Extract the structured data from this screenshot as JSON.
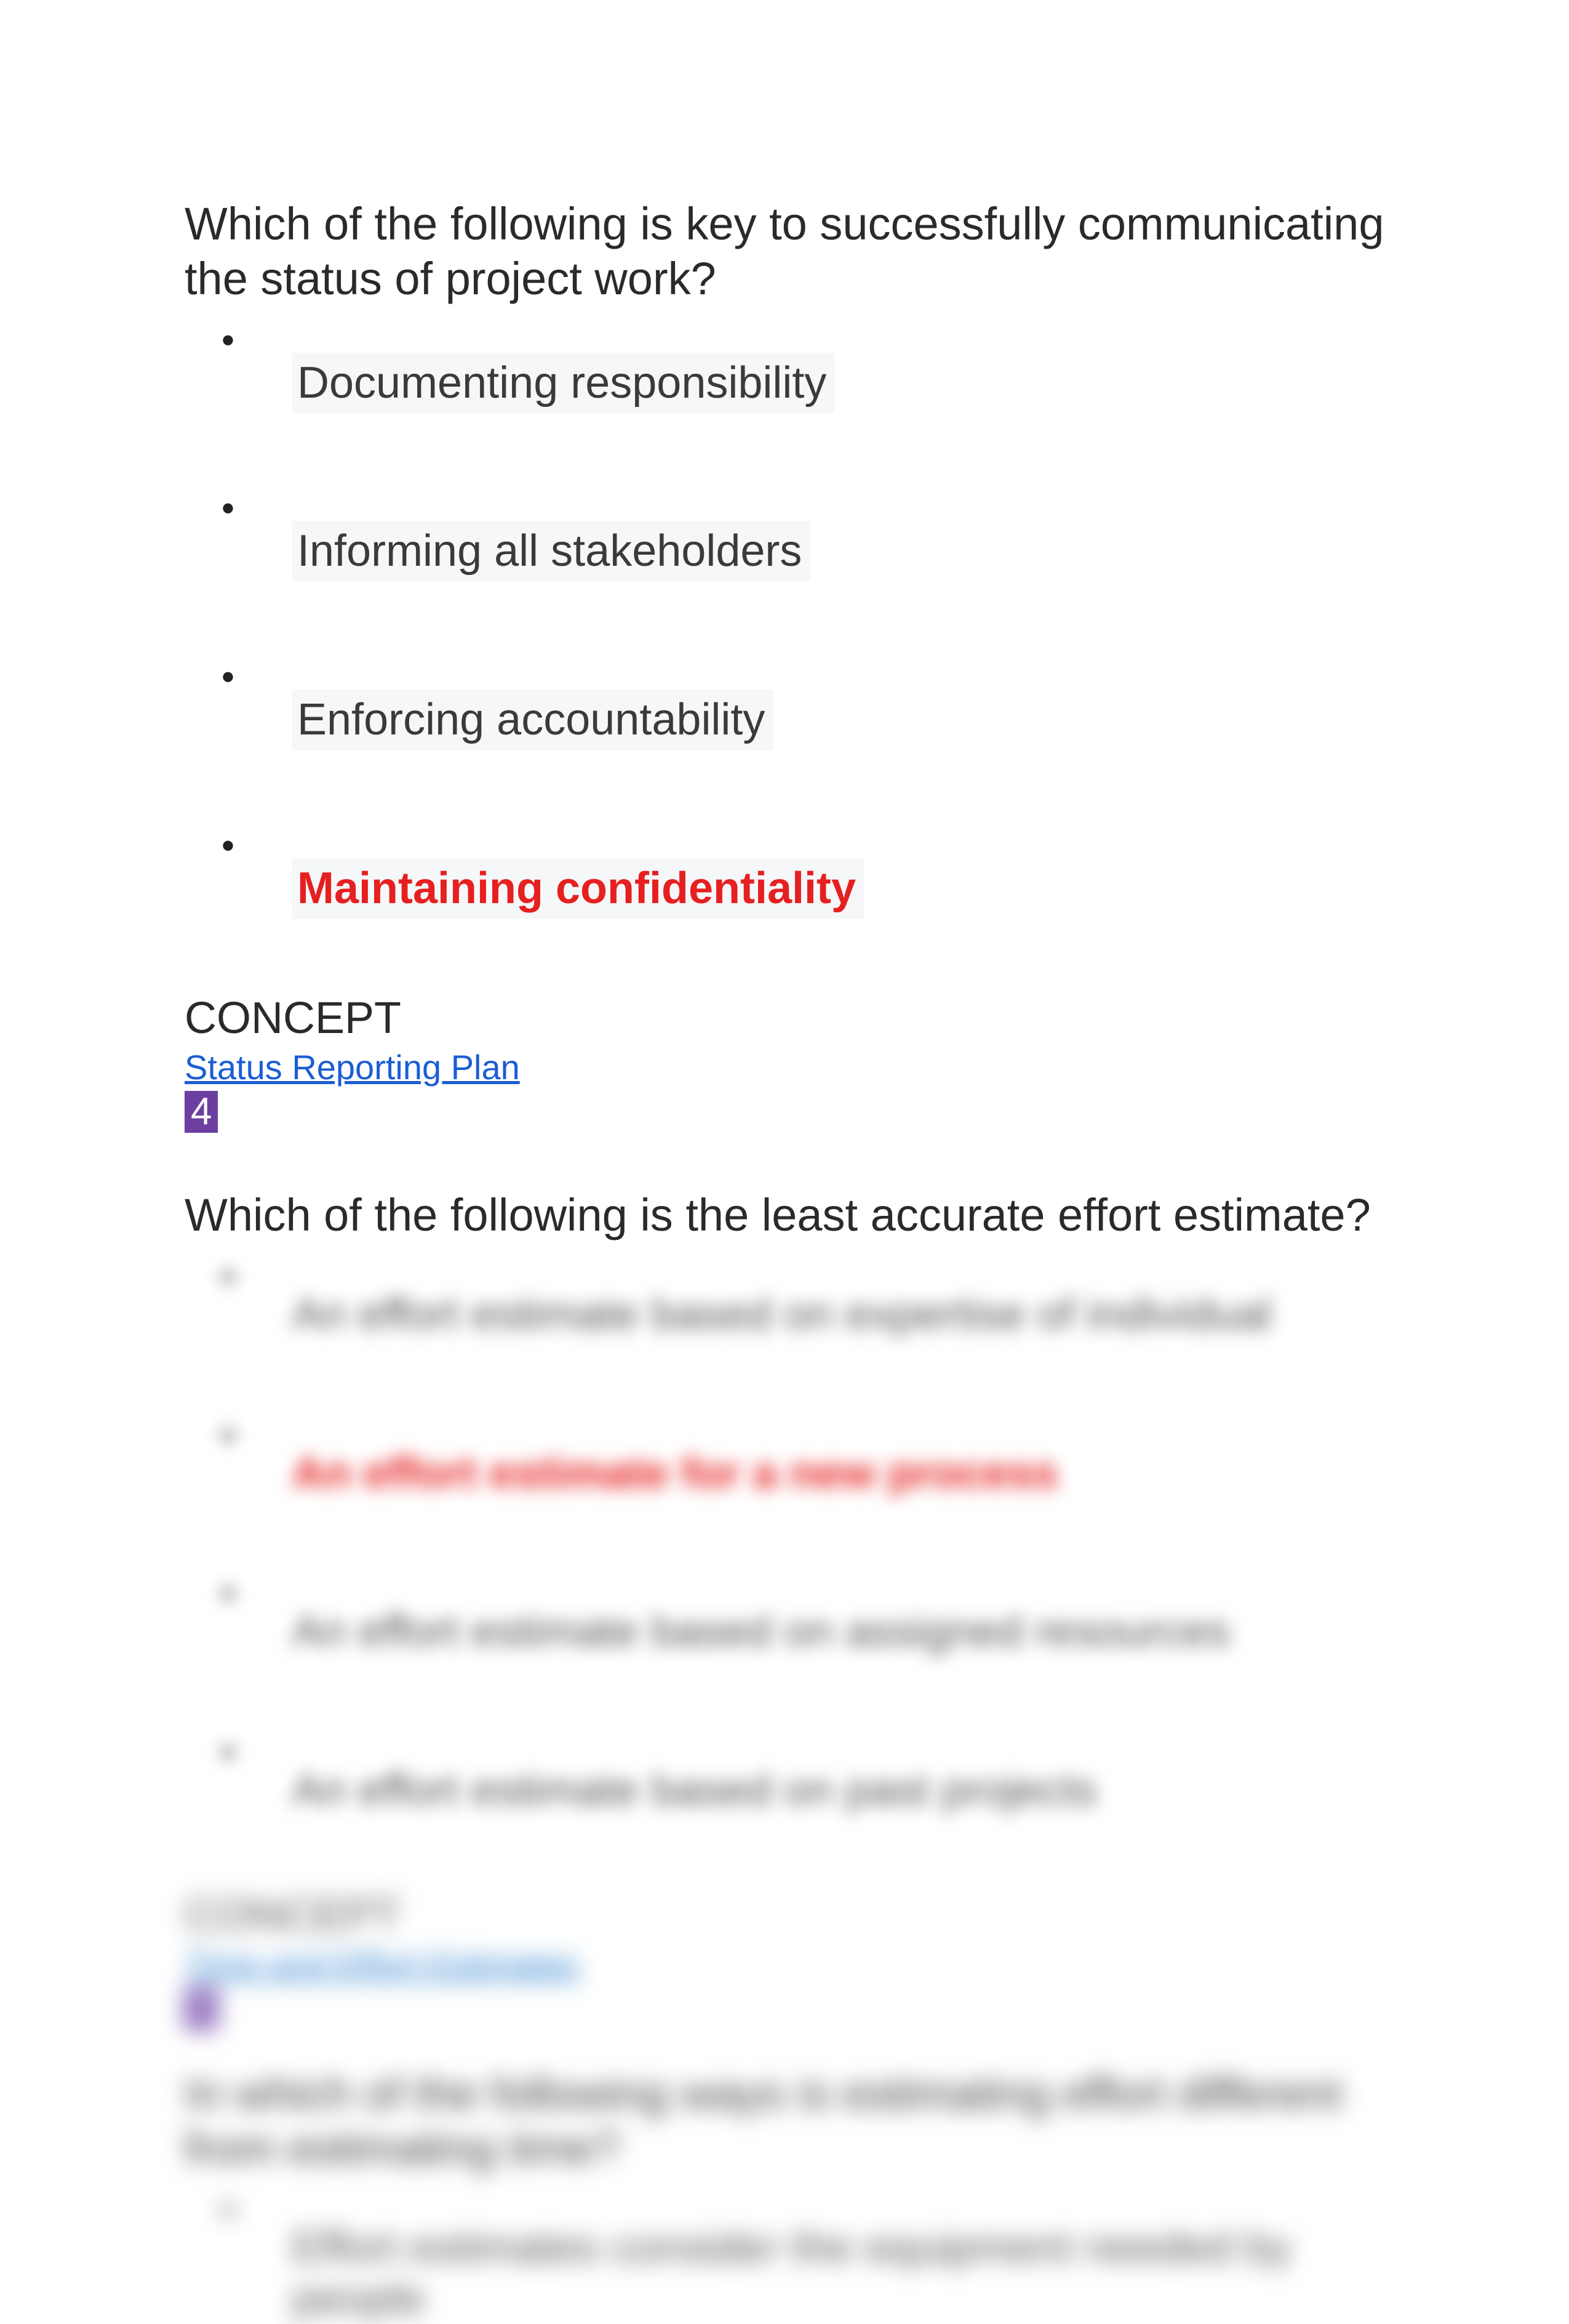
{
  "q1": {
    "question": "Which of the following is key to successfully communicating the status of project work?",
    "options": [
      "Documenting responsibility",
      "Informing all stakeholders",
      "Enforcing accountability",
      "Maintaining confidentiality"
    ],
    "concept_label": "CONCEPT",
    "concept_link": "Status Reporting Plan",
    "number": "4"
  },
  "q2": {
    "question": "Which of the following is the least accurate effort estimate?",
    "blurred_options": [
      "An effort estimate based on expertise of individual",
      "An effort estimate for a new process",
      "An effort estimate based on assigned resources",
      "An effort estimate based on past projects"
    ],
    "concept_label": "CONCEPT",
    "concept_link": "Time and Effort Estimates",
    "number": "5"
  },
  "q3": {
    "question": "In which of the following ways is estimating effort different from estimating time?",
    "blurred_options": [
      "Effort estimates consider the equipment needed by people"
    ]
  }
}
